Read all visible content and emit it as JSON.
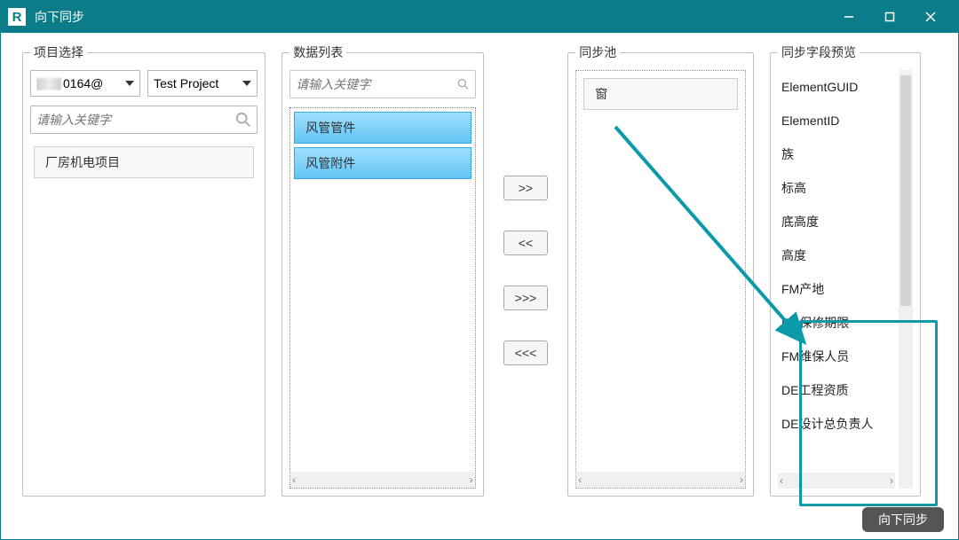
{
  "window": {
    "title": "向下同步"
  },
  "groups": {
    "project": "项目选择",
    "data": "数据列表",
    "pool": "同步池",
    "fields": "同步字段预览"
  },
  "project": {
    "dropdown1_suffix": "0164@",
    "dropdown2": "Test Project",
    "search_placeholder": "请输入关键字",
    "items": [
      "厂房机电项目"
    ]
  },
  "data": {
    "search_placeholder": "请输入关键字",
    "items": [
      "风管管件",
      "风管附件"
    ]
  },
  "transfer": {
    "add": ">>",
    "remove": "<<",
    "addall": ">>>",
    "removeall": "<<<"
  },
  "pool": {
    "items": [
      "窗"
    ]
  },
  "fields": {
    "items": [
      "ElementGUID",
      "ElementID",
      "族",
      "标高",
      "底高度",
      "高度",
      "FM产地",
      "FM保修期限",
      "FM维保人员",
      "DE工程资质",
      "DE设计总负责人"
    ]
  },
  "footer": {
    "sync": "向下同步"
  }
}
